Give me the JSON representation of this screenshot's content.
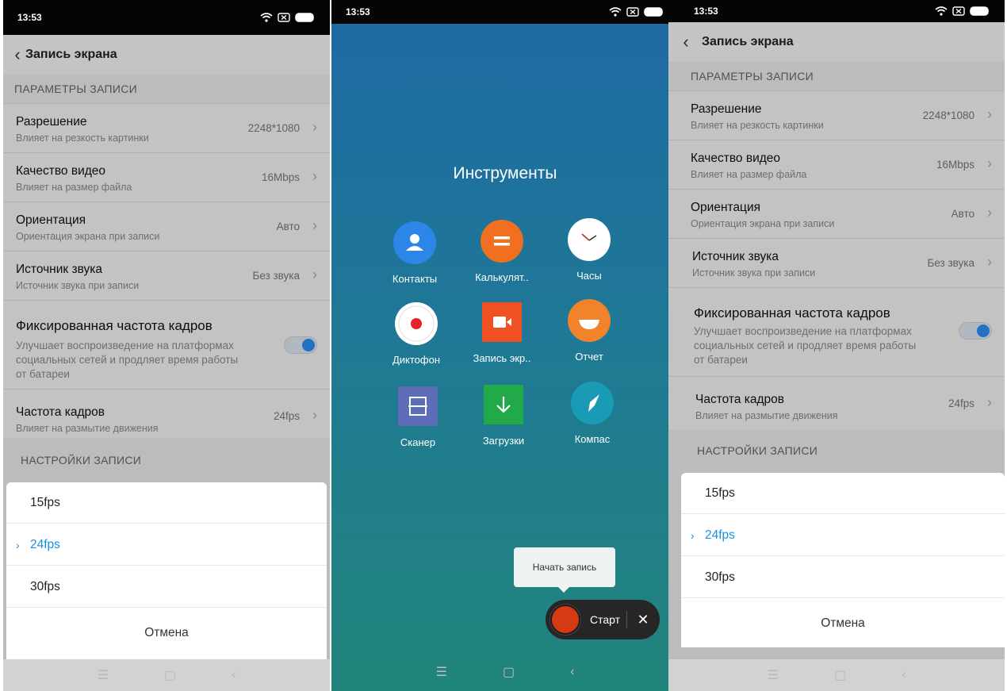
{
  "colors": {
    "accent": "#1a8fe3",
    "tools_bg": "#1f7896",
    "record": "#d63a12"
  },
  "screen_left": {
    "status": {
      "time": "13:53"
    },
    "header": {
      "title": "Запись экрана"
    },
    "section_params": "ПАРАМЕТРЫ ЗАПИСИ",
    "rows": [
      {
        "title": "Разрешение",
        "subtitle": "Влияет на резкость картинки",
        "value": "2248*1080"
      },
      {
        "title": "Качество видео",
        "subtitle": "Влияет на размер файла",
        "value": "16Mbps"
      },
      {
        "title": "Ориентация",
        "subtitle": "Ориентация экрана при записи",
        "value": "Авто"
      },
      {
        "title": "Источник звука",
        "subtitle": "Источник звука при записи",
        "value": "Без звука"
      }
    ],
    "fixed_fps": {
      "title": "Фиксированная частота кадров",
      "subtitle_lines": [
        "Улучшает воспроизведение на платформах",
        "социальных сетей и продляет время работы",
        "от батареи"
      ],
      "enabled": true
    },
    "frame_rate": {
      "title": "Частота кадров",
      "subtitle": "Влияет на размытие движения",
      "value": "24fps"
    },
    "section_settings": "НАСТРОЙКИ ЗАПИСИ",
    "sheet": {
      "options": [
        "15fps",
        "24fps",
        "30fps"
      ],
      "selected": "24fps",
      "cancel": "Отмена"
    }
  },
  "screen_middle": {
    "status": {
      "time": "13:53"
    },
    "title": "Инструменты",
    "tools": [
      {
        "label": "Контакты",
        "icon": "contacts-icon"
      },
      {
        "label": "Калькулят..",
        "icon": "calculator-icon"
      },
      {
        "label": "Часы",
        "icon": "clock-icon"
      },
      {
        "label": "Диктофон",
        "icon": "recorder-icon"
      },
      {
        "label": "Запись экр..",
        "icon": "screen-record-icon"
      },
      {
        "label": "Отчет",
        "icon": "feedback-icon"
      },
      {
        "label": "Сканер",
        "icon": "scanner-icon"
      },
      {
        "label": "Загрузки",
        "icon": "downloads-icon"
      },
      {
        "label": "Компас",
        "icon": "compass-icon"
      }
    ],
    "tooltip": "Начать запись",
    "start_label": "Старт"
  },
  "screen_right": {
    "status": {
      "time": "13:53"
    },
    "header": {
      "title": "Запись экрана"
    },
    "section_params": "ПАРАМЕТРЫ ЗАПИСИ",
    "rows": [
      {
        "title": "Разрешение",
        "subtitle": "Влияет на резкость картинки",
        "value": "2248*1080"
      },
      {
        "title": "Качество видео",
        "subtitle": "Влияет на размер файла",
        "value": "16Mbps"
      },
      {
        "title": "Ориентация",
        "subtitle": "Ориентация экрана при записи",
        "value": "Авто"
      },
      {
        "title": "Источник звука",
        "subtitle": "Источник звука при записи",
        "value": "Без звука"
      }
    ],
    "fixed_fps": {
      "title": "Фиксированная частота кадров",
      "subtitle_lines": [
        "Улучшает воспроизведение на платформах",
        "социальных сетей и продляет время работы",
        "от батареи"
      ],
      "enabled": true
    },
    "frame_rate": {
      "title": "Частота кадров",
      "subtitle": "Влияет на размытие движения",
      "value": "24fps"
    },
    "section_settings": "НАСТРОЙКИ ЗАПИСИ",
    "sheet": {
      "options": [
        "15fps",
        "24fps",
        "30fps"
      ],
      "selected": "24fps",
      "cancel": "Отмена"
    }
  }
}
